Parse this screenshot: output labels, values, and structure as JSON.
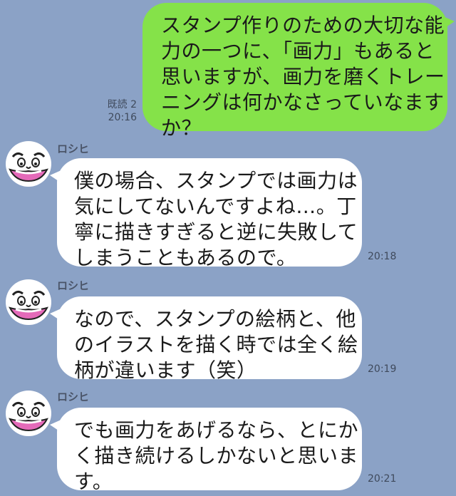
{
  "outgoing": {
    "lines": [
      "スタンプ作りのための大切な能",
      "力の一つに、「画力」もあると",
      "思いますが、画力を磨くトレー",
      "ニングは何かなさっていなます",
      "か？"
    ],
    "read_label": "既読 2",
    "time": "20:16",
    "bubble_color": "#85e249"
  },
  "messages": [
    {
      "sender": "ロシヒ",
      "lines": [
        "僕の場合、スタンプでは画力は",
        "気にしてないんですよね…。丁",
        "寧に描きすぎると逆に失敗して",
        "しまうこともあるので。"
      ],
      "time": "20:18"
    },
    {
      "sender": "ロシヒ",
      "lines": [
        "なので、スタンプの絵柄と、他",
        "のイラストを描く時では全く絵",
        "柄が違います（笑）"
      ],
      "time": "20:19"
    },
    {
      "sender": "ロシヒ",
      "lines": [
        "でも画力をあげるなら、とにか",
        "く描き続けるしかないと思いま",
        "す。"
      ],
      "time": "20:21"
    }
  ],
  "theme": {
    "background": "#8ba2c6",
    "incoming_bubble": "#ffffff"
  },
  "avatar_icon": "face-avatar-icon"
}
